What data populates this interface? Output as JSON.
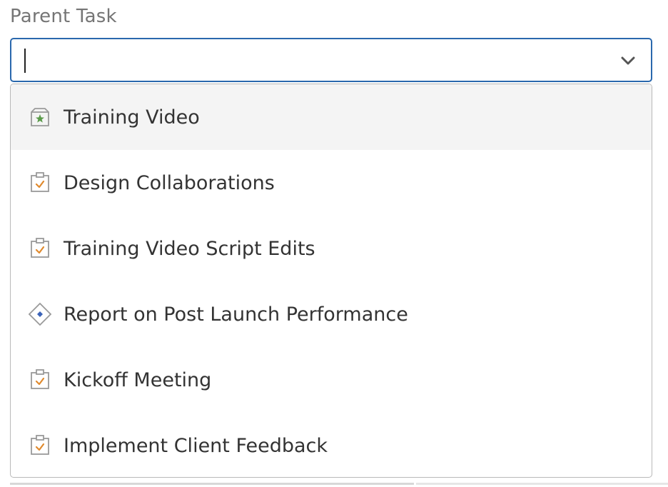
{
  "field": {
    "label": "Parent Task",
    "value": "",
    "placeholder": ""
  },
  "colors": {
    "focus_border": "#2a68ad",
    "milestone_star": "#5a9a4a",
    "task_check": "#e08a2e",
    "diamond_dot": "#3b63b8"
  },
  "options": [
    {
      "label": "Training Video",
      "icon": "milestone-star-icon"
    },
    {
      "label": "Design Collaborations",
      "icon": "task-clipboard-icon"
    },
    {
      "label": "Training Video Script Edits",
      "icon": "task-clipboard-icon"
    },
    {
      "label": "Report on Post Launch Performance",
      "icon": "diamond-icon"
    },
    {
      "label": "Kickoff Meeting",
      "icon": "task-clipboard-icon"
    },
    {
      "label": "Implement Client Feedback",
      "icon": "task-clipboard-icon"
    }
  ]
}
